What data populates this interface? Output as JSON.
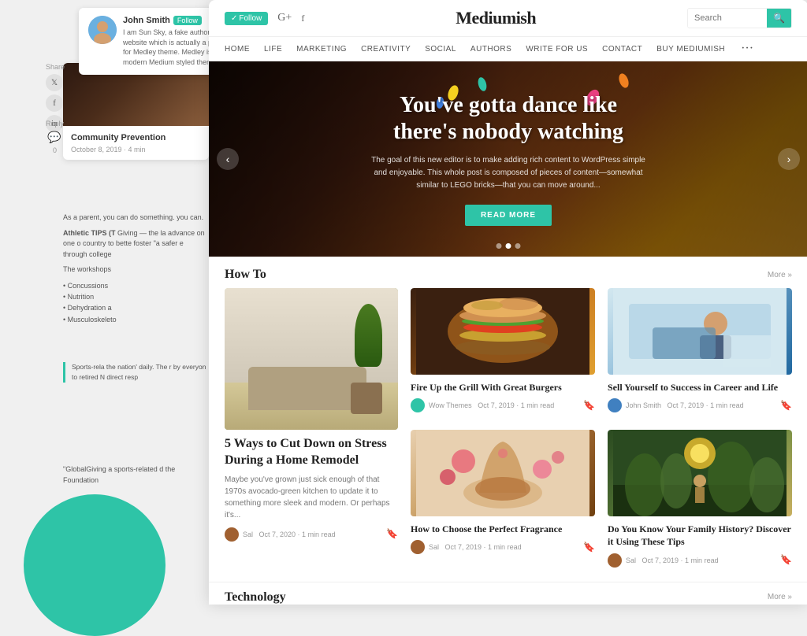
{
  "author": {
    "name": "John Smith",
    "description": "I am Sun Sky, a fake author at this website which is actually a preview for Medley theme. Medley is a very modern Medium styled theme!",
    "follow_label": "Follow"
  },
  "social": {
    "share_label": "Share",
    "reply_label": "Reply"
  },
  "left_article": {
    "title": "Community Prevention",
    "date": "October 8, 2019 · 4 min",
    "para1": "As a parent, you can do something. you can.",
    "para2_bold": "Athletic TIPS (T",
    "para2": "Giving — the la advance on one o country to bette foster \"a safer e through college",
    "para3": "The workshops",
    "bullets": [
      "Concussions",
      "Nutrition",
      "Dehydration a",
      "Musculoskeleto"
    ],
    "blockquote": "Sports-rela the nation' daily. The r by everyon to retired N direct resp",
    "global": "\"GlobalGiving a sports-related d the Foundation"
  },
  "nav": {
    "brand": "Mediumish",
    "follow_label": "Follow",
    "search_placeholder": "Search",
    "menu_items": [
      "HOME",
      "LIFE",
      "MARKETING",
      "CREATIVITY",
      "SOCIAL",
      "AUTHORS",
      "WRITE FOR US",
      "CONTACT",
      "BUY MEDIUMISH"
    ]
  },
  "hero": {
    "title": "You've gotta dance like there's nobody watching",
    "subtitle": "The goal of this new editor is to make adding rich content to WordPress simple and enjoyable. This whole post is composed of pieces of content—somewhat similar to LEGO bricks—that you can move around...",
    "read_more": "READ MORE"
  },
  "sections": {
    "how_to": {
      "title": "How To",
      "more": "More »"
    },
    "technology": {
      "title": "Technology",
      "more": "More »"
    }
  },
  "articles": {
    "large": {
      "title": "5 Ways to Cut Down on Stress During a Home Remodel",
      "description": "Maybe you've grown just sick enough of that 1970s avocado-green kitchen to update it to something more sleek and modern. Or perhaps it's...",
      "author": "Sal",
      "date": "Oct 7, 2020 · 1 min read"
    },
    "burger": {
      "title": "Fire Up the Grill With Great Burgers",
      "author": "Wow Themes",
      "date": "Oct 7, 2019 · 1 min read"
    },
    "career": {
      "title": "Sell Yourself to Success in Career and Life",
      "author": "John Smith",
      "date": "Oct 7, 2019 · 1 min read"
    },
    "fragrance": {
      "title": "How to Choose the Perfect Fragrance",
      "author": "Sal",
      "date": "Oct 7, 2019 · 1 min read"
    },
    "history": {
      "title": "Do You Know Your Family History? Discover it Using These Tips",
      "author": "Sal",
      "date": "Oct 7, 2019 · 1 min read"
    }
  }
}
